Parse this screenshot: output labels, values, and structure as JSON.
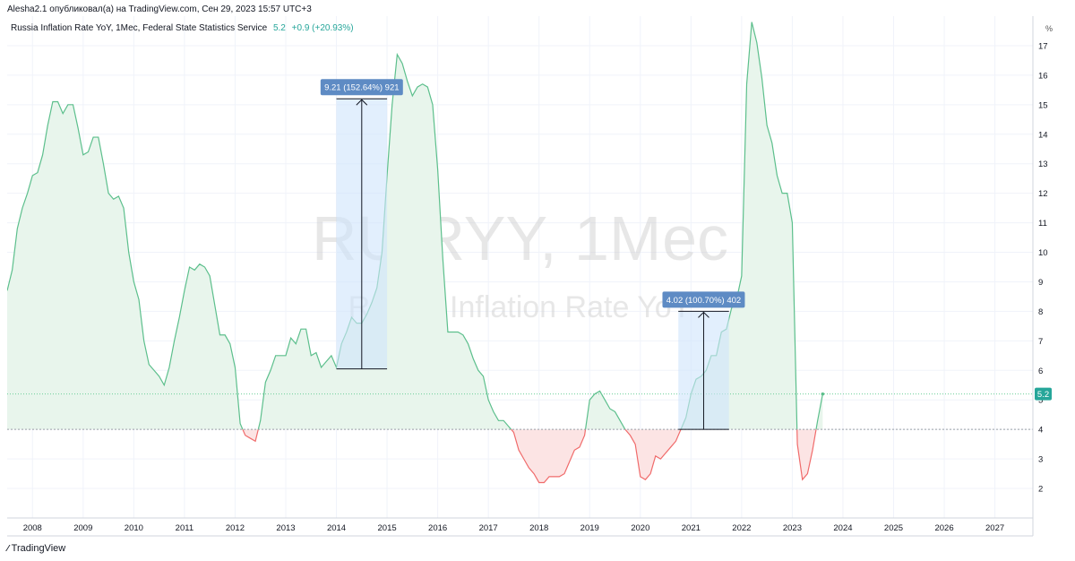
{
  "header": {
    "author_line": "Alesha2.1 опубликовал(а) на TradingView.com, Сен 29, 2023 15:57 UTC+3"
  },
  "legend": {
    "title": "Russia Inflation Rate YoY, 1Мес, Federal State Statistics Service",
    "value": "5.2",
    "change": "+0.9 (+20.93%)"
  },
  "toolbar": {
    "percent_label": "%"
  },
  "watermark": {
    "line1": "RUIRYY, 1Мес",
    "line2": "Russia Inflation Rate YoY"
  },
  "footer": {
    "brand": "TradingView"
  },
  "colors": {
    "line": "#5cbf8c",
    "fill_above": "#e8f5ec",
    "negative": "#f06b6b",
    "fill_below": "#fce4e4",
    "measure_fill": "#cfe5fb",
    "label_bg": "#5e8bc4"
  },
  "chart_data": {
    "type": "area",
    "title": "Russia Inflation Rate YoY, 1Мес, Federal State Statistics Service",
    "baseline": 4.0,
    "last_value": 5.2,
    "xlim": [
      2007.5,
      2027.75
    ],
    "ylim": [
      1.0,
      18.0
    ],
    "x_ticks": [
      "2008",
      "2009",
      "2010",
      "2011",
      "2012",
      "2013",
      "2014",
      "2015",
      "2016",
      "2017",
      "2018",
      "2019",
      "2020",
      "2021",
      "2022",
      "2023",
      "2024",
      "2025",
      "2026",
      "2027"
    ],
    "y_ticks": [
      "2",
      "3",
      "4",
      "5",
      "6",
      "7",
      "8",
      "9",
      "10",
      "11",
      "12",
      "13",
      "14",
      "15",
      "16",
      "17"
    ],
    "series": [
      {
        "points": [
          [
            2007.5,
            8.7
          ],
          [
            2007.6,
            9.4
          ],
          [
            2007.7,
            10.8
          ],
          [
            2007.8,
            11.5
          ],
          [
            2007.9,
            12.0
          ],
          [
            2008.0,
            12.6
          ],
          [
            2008.1,
            12.7
          ],
          [
            2008.2,
            13.3
          ],
          [
            2008.3,
            14.3
          ],
          [
            2008.4,
            15.1
          ],
          [
            2008.5,
            15.1
          ],
          [
            2008.6,
            14.7
          ],
          [
            2008.7,
            15.0
          ],
          [
            2008.8,
            15.0
          ],
          [
            2008.9,
            14.2
          ],
          [
            2009.0,
            13.3
          ],
          [
            2009.1,
            13.4
          ],
          [
            2009.2,
            13.9
          ],
          [
            2009.3,
            13.9
          ],
          [
            2009.4,
            13.0
          ],
          [
            2009.5,
            12.0
          ],
          [
            2009.6,
            11.8
          ],
          [
            2009.7,
            11.9
          ],
          [
            2009.8,
            11.5
          ],
          [
            2009.9,
            10.0
          ],
          [
            2010.0,
            9.0
          ],
          [
            2010.1,
            8.4
          ],
          [
            2010.2,
            7.0
          ],
          [
            2010.3,
            6.2
          ],
          [
            2010.4,
            6.0
          ],
          [
            2010.5,
            5.8
          ],
          [
            2010.6,
            5.5
          ],
          [
            2010.7,
            6.1
          ],
          [
            2010.8,
            7.0
          ],
          [
            2010.9,
            7.8
          ],
          [
            2011.0,
            8.7
          ],
          [
            2011.1,
            9.5
          ],
          [
            2011.2,
            9.4
          ],
          [
            2011.3,
            9.6
          ],
          [
            2011.4,
            9.5
          ],
          [
            2011.5,
            9.2
          ],
          [
            2011.6,
            8.2
          ],
          [
            2011.7,
            7.2
          ],
          [
            2011.8,
            7.2
          ],
          [
            2011.9,
            6.9
          ],
          [
            2012.0,
            6.1
          ],
          [
            2012.1,
            4.2
          ],
          [
            2012.2,
            3.8
          ],
          [
            2012.3,
            3.7
          ],
          [
            2012.4,
            3.6
          ],
          [
            2012.5,
            4.3
          ],
          [
            2012.6,
            5.6
          ],
          [
            2012.7,
            6.0
          ],
          [
            2012.8,
            6.5
          ],
          [
            2012.9,
            6.5
          ],
          [
            2013.0,
            6.5
          ],
          [
            2013.1,
            7.1
          ],
          [
            2013.2,
            6.9
          ],
          [
            2013.3,
            7.4
          ],
          [
            2013.4,
            7.4
          ],
          [
            2013.5,
            6.5
          ],
          [
            2013.6,
            6.6
          ],
          [
            2013.7,
            6.1
          ],
          [
            2013.8,
            6.3
          ],
          [
            2013.9,
            6.5
          ],
          [
            2014.0,
            6.1
          ],
          [
            2014.1,
            6.9
          ],
          [
            2014.2,
            7.3
          ],
          [
            2014.3,
            7.8
          ],
          [
            2014.4,
            7.6
          ],
          [
            2014.5,
            7.6
          ],
          [
            2014.6,
            7.9
          ],
          [
            2014.7,
            8.3
          ],
          [
            2014.8,
            8.8
          ],
          [
            2014.9,
            10.0
          ],
          [
            2015.0,
            12.6
          ],
          [
            2015.1,
            15.0
          ],
          [
            2015.2,
            16.7
          ],
          [
            2015.3,
            16.4
          ],
          [
            2015.4,
            15.8
          ],
          [
            2015.5,
            15.3
          ],
          [
            2015.6,
            15.6
          ],
          [
            2015.7,
            15.7
          ],
          [
            2015.8,
            15.6
          ],
          [
            2015.9,
            15.0
          ],
          [
            2016.0,
            12.8
          ],
          [
            2016.1,
            9.8
          ],
          [
            2016.2,
            7.3
          ],
          [
            2016.3,
            7.3
          ],
          [
            2016.4,
            7.3
          ],
          [
            2016.5,
            7.2
          ],
          [
            2016.6,
            6.9
          ],
          [
            2016.7,
            6.4
          ],
          [
            2016.8,
            6.0
          ],
          [
            2016.9,
            5.8
          ],
          [
            2017.0,
            5.0
          ],
          [
            2017.1,
            4.6
          ],
          [
            2017.2,
            4.3
          ],
          [
            2017.3,
            4.3
          ],
          [
            2017.4,
            4.1
          ],
          [
            2017.5,
            3.9
          ],
          [
            2017.6,
            3.3
          ],
          [
            2017.7,
            3.0
          ],
          [
            2017.8,
            2.7
          ],
          [
            2017.9,
            2.5
          ],
          [
            2018.0,
            2.2
          ],
          [
            2018.1,
            2.2
          ],
          [
            2018.2,
            2.4
          ],
          [
            2018.3,
            2.4
          ],
          [
            2018.4,
            2.4
          ],
          [
            2018.5,
            2.5
          ],
          [
            2018.6,
            2.9
          ],
          [
            2018.7,
            3.3
          ],
          [
            2018.8,
            3.4
          ],
          [
            2018.9,
            3.8
          ],
          [
            2019.0,
            5.0
          ],
          [
            2019.1,
            5.2
          ],
          [
            2019.2,
            5.3
          ],
          [
            2019.3,
            5.0
          ],
          [
            2019.4,
            4.7
          ],
          [
            2019.5,
            4.6
          ],
          [
            2019.6,
            4.3
          ],
          [
            2019.7,
            4.0
          ],
          [
            2019.8,
            3.8
          ],
          [
            2019.9,
            3.5
          ],
          [
            2020.0,
            2.4
          ],
          [
            2020.1,
            2.3
          ],
          [
            2020.2,
            2.5
          ],
          [
            2020.3,
            3.1
          ],
          [
            2020.4,
            3.0
          ],
          [
            2020.5,
            3.2
          ],
          [
            2020.6,
            3.4
          ],
          [
            2020.7,
            3.6
          ],
          [
            2020.8,
            4.0
          ],
          [
            2020.9,
            4.4
          ],
          [
            2021.0,
            5.2
          ],
          [
            2021.1,
            5.7
          ],
          [
            2021.2,
            5.8
          ],
          [
            2021.3,
            6.0
          ],
          [
            2021.4,
            6.5
          ],
          [
            2021.5,
            6.5
          ],
          [
            2021.6,
            7.3
          ],
          [
            2021.7,
            7.4
          ],
          [
            2021.8,
            8.1
          ],
          [
            2021.9,
            8.4
          ],
          [
            2022.0,
            9.2
          ],
          [
            2022.1,
            15.7
          ],
          [
            2022.2,
            17.8
          ],
          [
            2022.3,
            17.1
          ],
          [
            2022.4,
            15.9
          ],
          [
            2022.5,
            14.3
          ],
          [
            2022.6,
            13.7
          ],
          [
            2022.7,
            12.6
          ],
          [
            2022.8,
            12.0
          ],
          [
            2022.9,
            12.0
          ],
          [
            2023.0,
            11.0
          ],
          [
            2023.1,
            3.5
          ],
          [
            2023.2,
            2.3
          ],
          [
            2023.3,
            2.5
          ],
          [
            2023.4,
            3.3
          ],
          [
            2023.5,
            4.3
          ],
          [
            2023.6,
            5.2
          ]
        ]
      }
    ],
    "annotations": [
      {
        "label": "9.21 (152.64%) 921",
        "x_start": 2014.0,
        "x_end": 2015.0,
        "y_start": 6.05,
        "y_end": 15.2
      },
      {
        "label": "4.02 (100.70%) 402",
        "x_start": 2020.75,
        "x_end": 2021.75,
        "y_start": 4.0,
        "y_end": 8.0
      }
    ]
  }
}
